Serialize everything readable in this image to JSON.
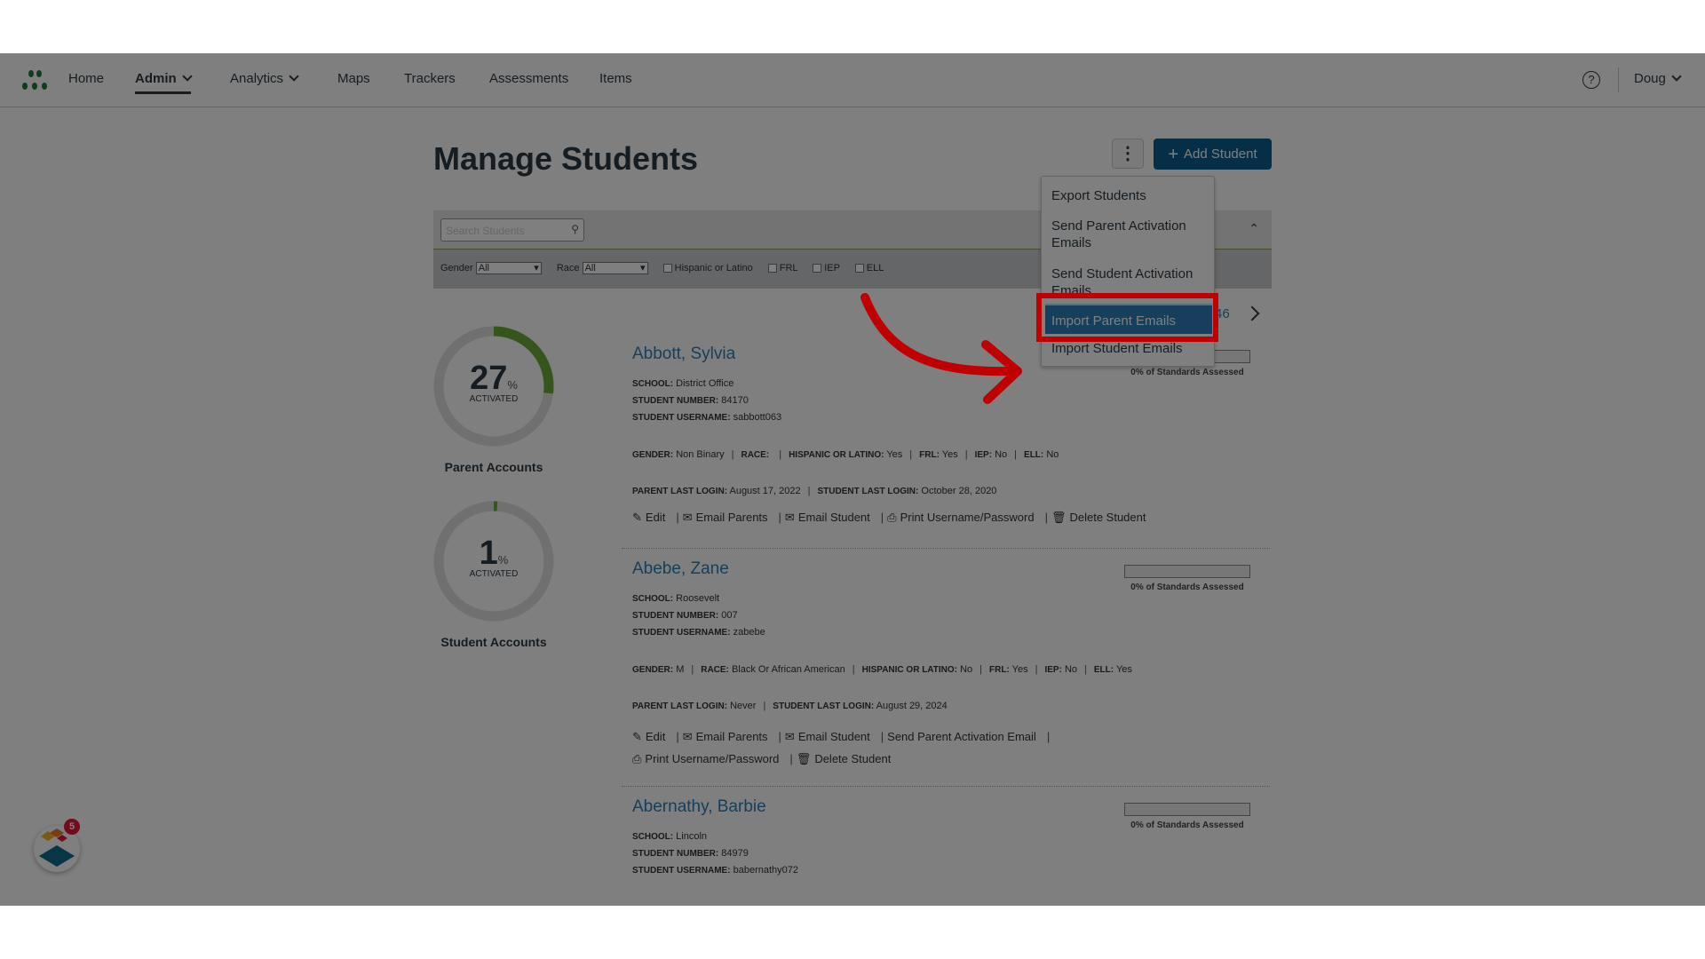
{
  "nav": {
    "home": "Home",
    "admin": "Admin",
    "analytics": "Analytics",
    "maps": "Maps",
    "trackers": "Trackers",
    "assessments": "Assessments",
    "items": "Items",
    "user": "Doug"
  },
  "page": {
    "title": "Manage Students",
    "add_student": "Add Student",
    "more_icon": "kebab-icon"
  },
  "filters": {
    "search_placeholder": "Search Students",
    "gender_label": "Gender",
    "gender_value": "All",
    "race_label": "Race",
    "race_value": "All",
    "hispanic": "Hispanic or Latino",
    "frl": "FRL",
    "iep": "IEP",
    "ell": "ELL"
  },
  "menu": {
    "items": [
      "Export Students",
      "Send Parent Activation Emails",
      "Send Student Activation Emails",
      "Import Parent Emails",
      "Import Student Emails"
    ],
    "highlighted": "Import Parent Emails"
  },
  "pagination": {
    "last_page": "46"
  },
  "stats": {
    "parent": {
      "value": 27,
      "pct": "27",
      "unit": "%",
      "sub": "ACTIVATED",
      "label": "Parent Accounts"
    },
    "student": {
      "value": 1,
      "pct": "1",
      "unit": "%",
      "sub": "ACTIVATED",
      "label": "Student Accounts"
    }
  },
  "labels": {
    "school": "SCHOOL:",
    "number": "STUDENT NUMBER:",
    "username": "STUDENT USERNAME:",
    "gender": "GENDER:",
    "race": "RACE:",
    "hispanic": "HISPANIC OR LATINO:",
    "frl": "FRL:",
    "iep": "IEP:",
    "ell": "ELL:",
    "parent_login": "PARENT LAST LOGIN:",
    "student_login": "STUDENT LAST LOGIN:",
    "standards": "0% of Standards Assessed",
    "edit": "Edit",
    "email_parents": "Email Parents",
    "email_student": "Email Student",
    "print": "Print Username/Password",
    "delete": "Delete Student",
    "send_parent_activation": "Send Parent Activation Email"
  },
  "students": [
    {
      "name": "Abbott, Sylvia",
      "school": "District Office",
      "number": "84170",
      "username": "sabbott063",
      "gender": "Non Binary",
      "race": "",
      "hispanic": "Yes",
      "frl": "Yes",
      "iep": "No",
      "ell": "No",
      "parent_login": "August 17, 2022",
      "student_login": "October 28, 2020",
      "standards_pct": 0
    },
    {
      "name": "Abebe, Zane",
      "school": "Roosevelt",
      "number": "007",
      "username": "zabebe",
      "gender": "M",
      "race": "Black Or African American",
      "hispanic": "No",
      "frl": "Yes",
      "iep": "No",
      "ell": "Yes",
      "parent_login": "Never",
      "student_login": "August 29, 2024",
      "standards_pct": 0
    },
    {
      "name": "Abernathy, Barbie",
      "school": "Lincoln",
      "number": "84979",
      "username": "babernathy072",
      "standards_pct": 0
    }
  ],
  "widget": {
    "badge": "5"
  },
  "colors": {
    "accent": "#0b5f8f",
    "link": "#2b7fb8",
    "progress": "#6aab3b",
    "annotation": "#c00000"
  }
}
